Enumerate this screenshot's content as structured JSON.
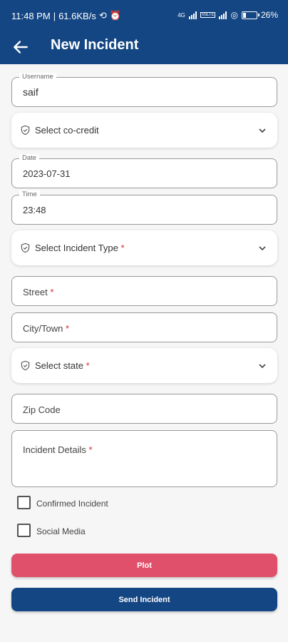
{
  "status_bar": {
    "time": "11:48 PM",
    "speed": "61.6KB/s",
    "network_label": "4G",
    "volte_label": "VoLTE",
    "battery": "26"
  },
  "appbar": {
    "title": "New Incident"
  },
  "form": {
    "username": {
      "label": "Username",
      "value": "saif"
    },
    "co_credit": {
      "text": "Select co-credit"
    },
    "date": {
      "label": "Date",
      "value": "2023-07-31"
    },
    "time": {
      "label": "Time",
      "value": "23:48"
    },
    "incident_type": {
      "text": "Select Incident Type",
      "required": "*"
    },
    "street": {
      "placeholder": "Street",
      "required": "*"
    },
    "city": {
      "placeholder": "City/Town",
      "required": "*"
    },
    "state": {
      "text": "Select state",
      "required": "*"
    },
    "zip": {
      "placeholder": "Zip Code"
    },
    "details": {
      "placeholder": "Incident Details",
      "required": "*"
    },
    "confirmed": {
      "label": "Confirmed Incident",
      "checked": false
    },
    "social": {
      "label": "Social Media",
      "checked": false
    }
  },
  "buttons": {
    "plot": "Plot",
    "send": "Send Incident"
  },
  "colors": {
    "primary": "#144683",
    "plot": "#e0506a",
    "required": "#d32f2f"
  },
  "battery_level": 0.26
}
